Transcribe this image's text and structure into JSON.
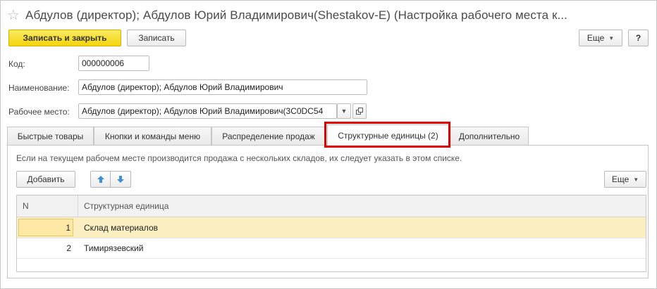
{
  "window": {
    "title": "Абдулов (директор); Абдулов Юрий Владимирович(Shestakov-E) (Настройка рабочего места к..."
  },
  "toolbar": {
    "save_close_label": "Записать и закрыть",
    "save_label": "Записать",
    "more_label": "Еще",
    "help_label": "?"
  },
  "form": {
    "code_label": "Код:",
    "code_value": "000000006",
    "name_label": "Наименование:",
    "name_value": "Абдулов (директор); Абдулов Юрий Владимирович",
    "workplace_label": "Рабочее место:",
    "workplace_value": "Абдулов (директор); Абдулов Юрий Владимирович(3C0DC54"
  },
  "tabs": [
    {
      "label": "Быстрые товары"
    },
    {
      "label": "Кнопки и команды меню"
    },
    {
      "label": "Распределение продаж"
    },
    {
      "label": "Структурные единицы (2)",
      "active": true
    },
    {
      "label": "Дополнительно"
    }
  ],
  "panel": {
    "info_text": "Если на текущем рабочем месте производится продажа с нескольких складов, их следует указать в этом списке.",
    "add_label": "Добавить",
    "more_label": "Еще"
  },
  "table": {
    "columns": [
      "N",
      "Структурная единица"
    ],
    "rows": [
      {
        "n": "1",
        "unit": "Склад материалов",
        "selected": true
      },
      {
        "n": "2",
        "unit": "Тимирязевский",
        "selected": false
      }
    ]
  },
  "colors": {
    "primary_button": "#f4d50c",
    "selected_row": "#fbeec0",
    "highlight_border": "#e10000",
    "arrow_blue": "#3d8fd9"
  }
}
